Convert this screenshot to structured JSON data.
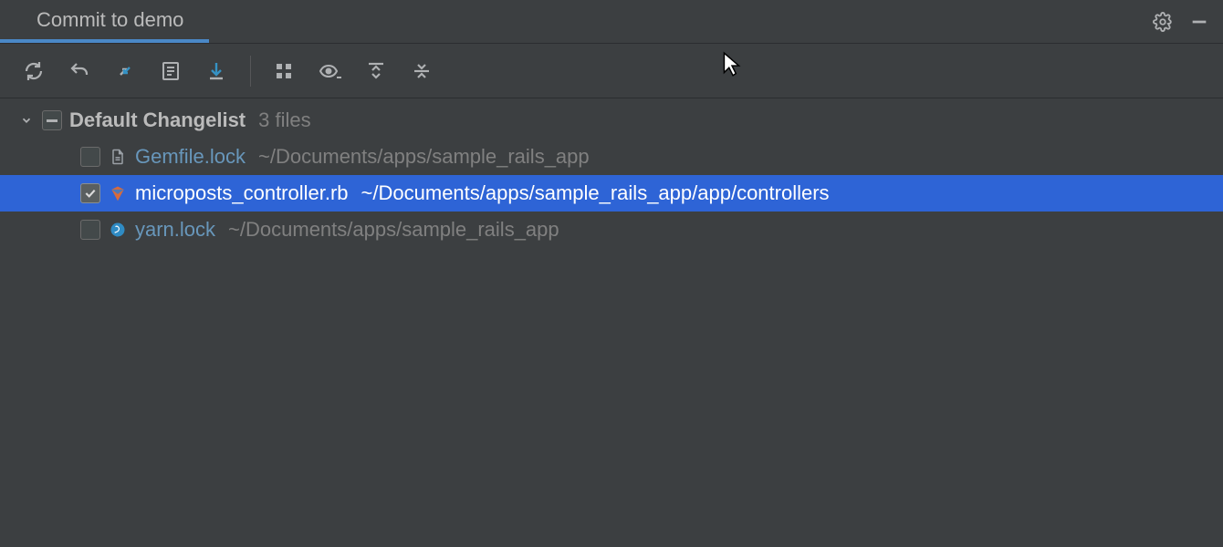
{
  "header": {
    "title": "Commit to demo"
  },
  "toolbar": {
    "icons": [
      "refresh",
      "rollback",
      "swap",
      "diff",
      "shelve",
      "group",
      "show",
      "expand-all",
      "collapse-all"
    ]
  },
  "changelist": {
    "name": "Default Changelist",
    "count_label": "3 files",
    "files": [
      {
        "name": "Gemfile.lock",
        "path": "~/Documents/apps/sample_rails_app",
        "checked": false,
        "selected": false,
        "icon": "text"
      },
      {
        "name": "microposts_controller.rb",
        "path": "~/Documents/apps/sample_rails_app/app/controllers",
        "checked": true,
        "selected": true,
        "icon": "ruby"
      },
      {
        "name": "yarn.lock",
        "path": "~/Documents/apps/sample_rails_app",
        "checked": false,
        "selected": false,
        "icon": "yarn"
      }
    ]
  }
}
